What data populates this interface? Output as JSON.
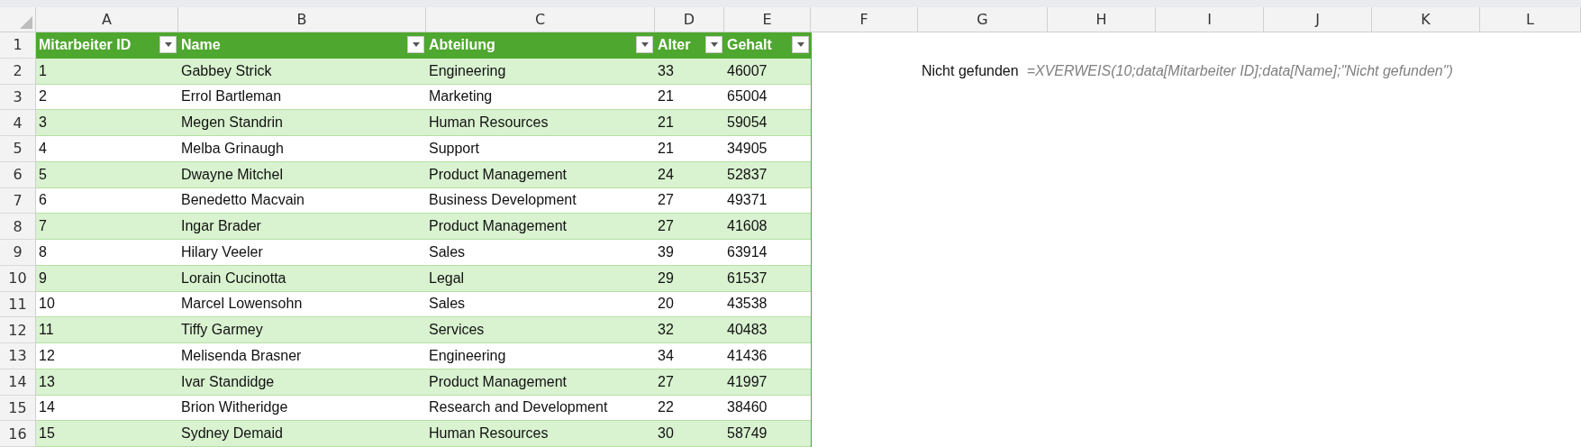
{
  "column_letters": [
    "A",
    "B",
    "C",
    "D",
    "E",
    "F",
    "G",
    "H",
    "I",
    "J",
    "K",
    "L"
  ],
  "table": {
    "columns": [
      "Mitarbeiter ID",
      "Name",
      "Abteilung",
      "Alter",
      "Gehalt"
    ],
    "rows": [
      [
        "1",
        "Gabbey Strick",
        "Engineering",
        "33",
        "46007"
      ],
      [
        "2",
        "Errol Bartleman",
        "Marketing",
        "21",
        "65004"
      ],
      [
        "3",
        "Megen Standrin",
        "Human Resources",
        "21",
        "59054"
      ],
      [
        "4",
        "Melba Grinaugh",
        "Support",
        "21",
        "34905"
      ],
      [
        "5",
        "Dwayne Mitchel",
        "Product Management",
        "24",
        "52837"
      ],
      [
        "6",
        "Benedetto Macvain",
        "Business Development",
        "27",
        "49371"
      ],
      [
        "7",
        "Ingar Brader",
        "Product Management",
        "27",
        "41608"
      ],
      [
        "8",
        "Hilary Veeler",
        "Sales",
        "39",
        "63914"
      ],
      [
        "9",
        "Lorain Cucinotta",
        "Legal",
        "29",
        "61537"
      ],
      [
        "10",
        "Marcel Lowensohn",
        "Sales",
        "20",
        "43538"
      ],
      [
        "11",
        "Tiffy Garmey",
        "Services",
        "32",
        "40483"
      ],
      [
        "12",
        "Melisenda Brasner",
        "Engineering",
        "34",
        "41436"
      ],
      [
        "13",
        "Ivar Standidge",
        "Product Management",
        "27",
        "41997"
      ],
      [
        "14",
        "Brion Witheridge",
        "Research and Development",
        "22",
        "38460"
      ],
      [
        "15",
        "Sydney Demaid",
        "Human Resources",
        "30",
        "58749"
      ]
    ]
  },
  "row_numbers": [
    "1",
    "2",
    "3",
    "4",
    "5",
    "6",
    "7",
    "8",
    "9",
    "10",
    "11",
    "12",
    "13",
    "14",
    "15",
    "16"
  ],
  "lookup": {
    "result": "Nicht gefunden",
    "formula": "=XVERWEIS(10;data[Mitarbeiter ID];data[Name];\"Nicht gefunden\")"
  }
}
